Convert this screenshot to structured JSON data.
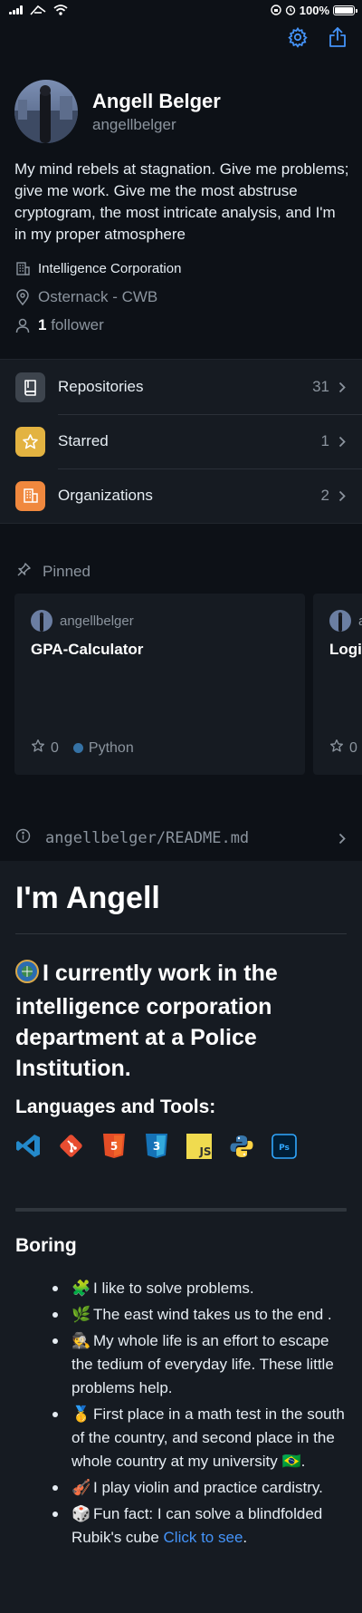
{
  "status_bar": {
    "battery": "100%",
    "battery_level": 1.0
  },
  "toolbar": {
    "settings_icon": "gear-icon",
    "share_icon": "share-icon"
  },
  "profile": {
    "name": "Angell Belger",
    "login": "angellbelger",
    "bio": "My mind rebels at stagnation. Give me problems; give me work. Give me the most abstruse cryptogram, the most intricate analysis, and I'm in my proper atmosphere",
    "company": "Intelligence Corporation",
    "location": "Osternack - CWB",
    "followers_count": "1",
    "followers_label": " follower"
  },
  "menu": {
    "items": [
      {
        "label": "Repositories",
        "count": "31",
        "icon": "repo-icon",
        "color": "#3d444d"
      },
      {
        "label": "Starred",
        "count": "1",
        "icon": "star-icon",
        "color": "#e3b341"
      },
      {
        "label": "Organizations",
        "count": "2",
        "icon": "organization-icon",
        "color": "#f0883e"
      }
    ]
  },
  "pinned": {
    "label": "Pinned",
    "cards": [
      {
        "owner": "angellbelger",
        "title": "GPA-Calculator",
        "stars": "0",
        "language": "Python",
        "language_color": "#3572A5"
      },
      {
        "owner": "angellbelger",
        "title": "Logic",
        "stars": "0",
        "language": "",
        "language_color": ""
      }
    ]
  },
  "readme": {
    "path": "angellbelger/README.md",
    "h1": "I'm Angell",
    "h2": "I currently work in the intelligence corporation department at a Police Institution.",
    "h2_emoji": "globe-badge",
    "tools_heading": "Languages and Tools:",
    "tools": [
      "vscode",
      "git",
      "html5",
      "css3",
      "javascript",
      "python",
      "photoshop"
    ],
    "section_heading": "Boring",
    "items": [
      {
        "emoji": "🧩",
        "text": "I like to solve problems."
      },
      {
        "emoji": "🌿",
        "text": "The east wind takes us to the end ."
      },
      {
        "emoji": "🕵",
        "text": "My whole life is an effort to escape the tedium of everyday life. These little problems help."
      },
      {
        "emoji": "🥇",
        "text": "First place in a math test in the south of the country, and second place in the whole country at my university",
        "suffix_emoji": "🇧🇷",
        "suffix": "."
      },
      {
        "emoji": "🎻",
        "text": "I play violin and practice cardistry."
      },
      {
        "emoji": "🎲",
        "text": "Fun fact: I can solve a blindfolded Rubik's cube ",
        "link": "Click to see",
        "suffix": "."
      }
    ]
  },
  "colors": {
    "background": "#0d1117",
    "surface": "#161b22",
    "accent": "#4493f8",
    "muted": "#8b949e"
  }
}
